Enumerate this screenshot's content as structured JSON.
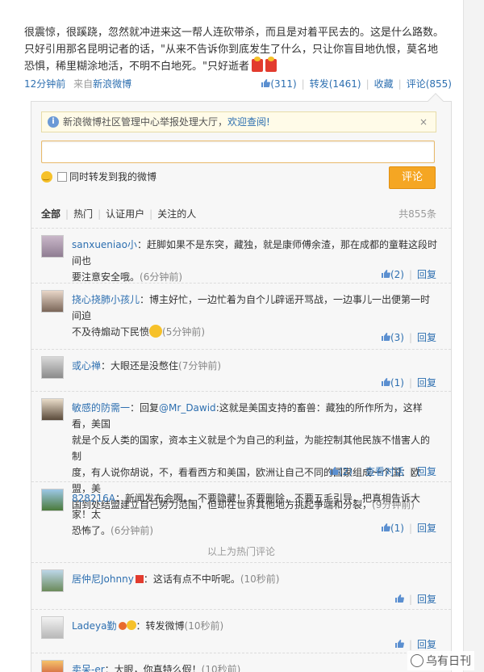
{
  "post": {
    "text_line1": "很震惊，很蹊跷，忽然就冲进来这一帮人连砍带杀，而且是对着平民去的。这是什么路数。",
    "text_line2": "只好引用那名昆明记者的话，\"从来不告诉你到底发生了什么，只让你盲目地仇恨，莫名地",
    "text_line3": "恐惧，稀里糊涂地活，不明不白地死。\"只好逝者",
    "time": "12分钟前",
    "source_prefix": "来自",
    "source": "新浪微博",
    "like_count": "(311)",
    "repost_label": "转发(1461)",
    "fav_label": "收藏",
    "comment_label": "评论(855)"
  },
  "notice": {
    "text": "新浪微博社区管理中心举报处理大厅，",
    "link": "欢迎查阅!",
    "close": "×"
  },
  "reply": {
    "input_value": "",
    "also_repost": "同时转发到我的微博",
    "submit_label": "评论"
  },
  "filters": {
    "all": "全部",
    "hot": "热门",
    "verified": "认证用户",
    "following": "关注的人",
    "total": "共855条"
  },
  "comments": [
    {
      "user": "sanxueniao小",
      "text": "：赶脚如果不是东突，藏独，就是康师傅余渣，那在成都的童鞋这段时间也",
      "text2": "要注意安全哦。",
      "time": "(6分钟前)",
      "likes": "(2)",
      "reply": "回复"
    },
    {
      "user": "挠心挠肺小孩儿",
      "text": "：博主好忙，一边忙着为自个儿辟谣开骂战，一边事儿一出便第一时间迫",
      "text2": "不及待煽动下民愤",
      "time": "(5分钟前)",
      "likes": "(3)",
      "reply": "回复"
    },
    {
      "user": "或心禅",
      "text": "：大眼还是没憋住",
      "time": "(7分钟前)",
      "likes": "(1)",
      "reply": "回复"
    },
    {
      "user": "敏感的防需一",
      "text_prefix": "：回复",
      "mention": "@Mr_Dawid",
      "text": ":这就是美国支持的畜兽：藏独的所作所为，这样看，美国",
      "text2": "就是个反人类的国家，资本主义就是个为自己的利益，为能控制其他民族不惜害人的制",
      "text3": "度，有人说你胡说，不，看看西方和美国，欧洲让自己不同的国家组成一个国：欧盟，美",
      "text4": "国到处结盟建立自己势力范围，但却在世界其他地方挑起争端和分裂，",
      "time": "(9分钟前)",
      "likes": "(2)",
      "view_thread": "查看对话",
      "reply": "回复"
    },
    {
      "user": "828216A",
      "text": "：新闻发布会啊。。不要隐藏！不要删除，不要五毛引导，把真相告诉大家！太",
      "text2": "恐怖了。",
      "time": "(6分钟前)",
      "likes": "(1)",
      "reply": "回复"
    },
    {
      "user": "居仲尼Johnny",
      "text": "：这话有点不中听呢。",
      "time": "(10秒前)",
      "likes": "",
      "reply": "回复"
    },
    {
      "user": "Ladeya勤",
      "text": "：转发微博",
      "time": "(10秒前)",
      "likes": "",
      "reply": "回复"
    },
    {
      "user": "卖呆-er",
      "text": "：大眼，你真特么假！",
      "time": "(10秒前)"
    }
  ],
  "hot_divider": "以上为热门评论",
  "watermark": "乌有日刊",
  "colors": {
    "link": "#2d6fb0",
    "accent": "#f5a623",
    "notice_bg": "#fffbe8"
  }
}
